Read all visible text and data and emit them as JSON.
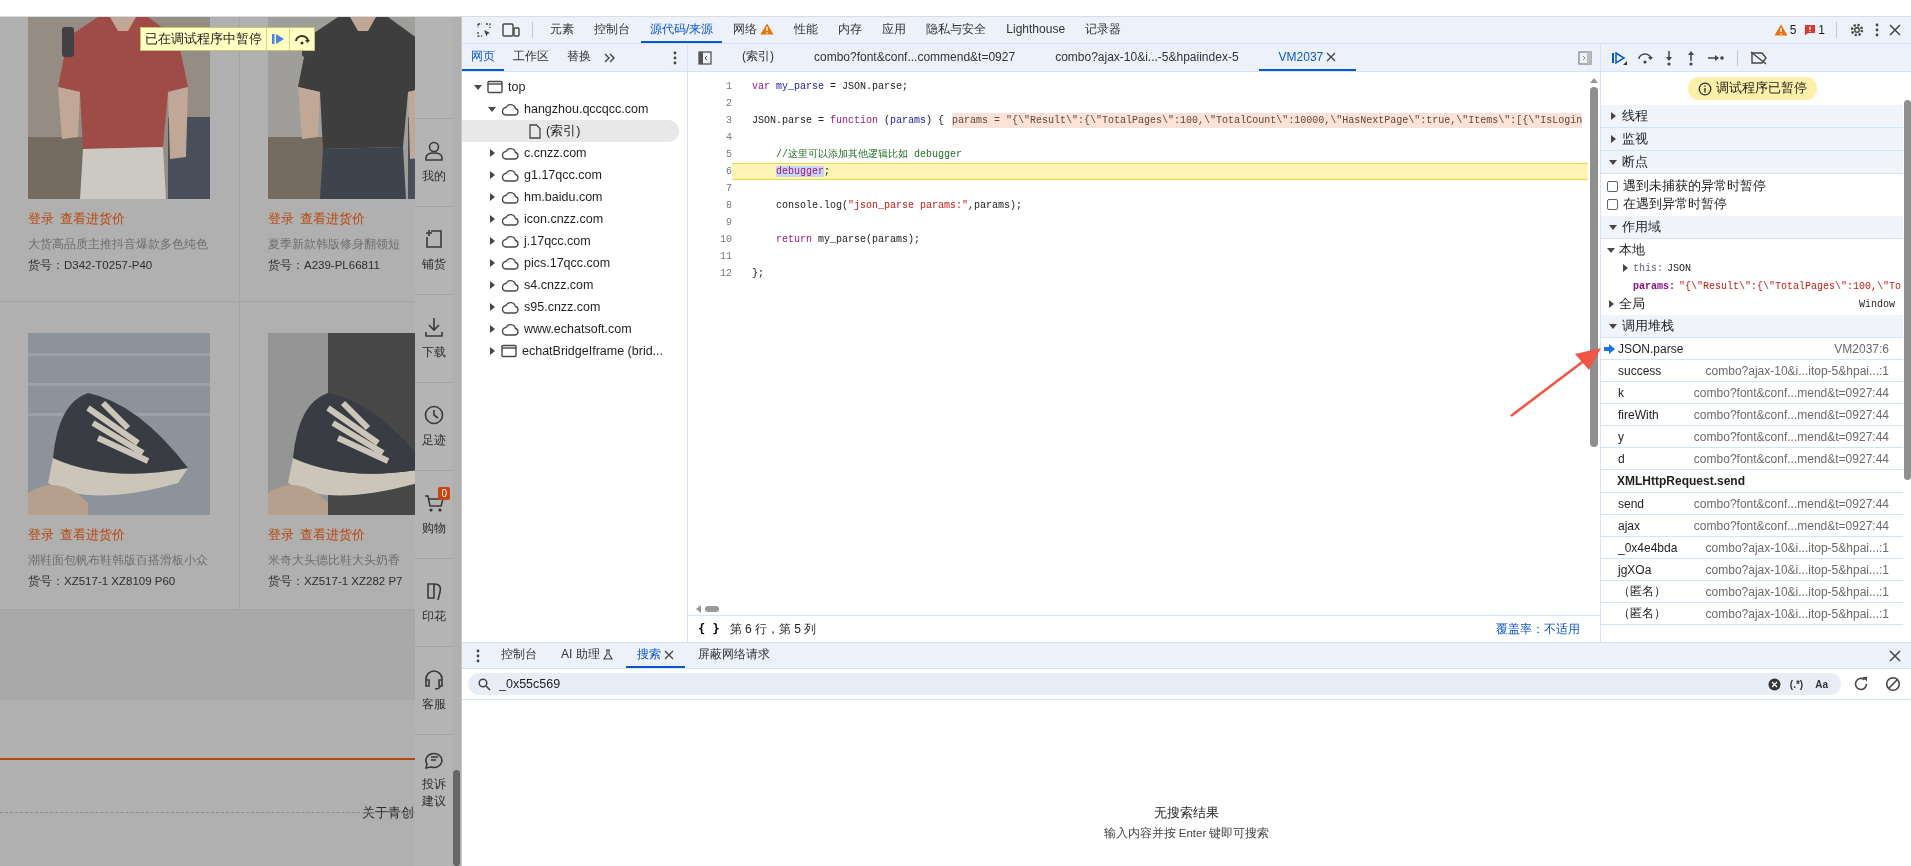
{
  "page": {
    "paused_banner": {
      "text": "已在调试程序中暂停"
    },
    "products": [
      {
        "login": "登录",
        "price_link": "查看进货价",
        "title": "大货高品质主推抖音爆款多色纯色",
        "sku": "货号：D342-T0257-P40"
      },
      {
        "login": "登录",
        "price_link": "查看进货价",
        "title": "夏季新款韩版修身翻领短",
        "sku": "货号：A239-PL66811"
      },
      {
        "login": "登录",
        "price_link": "查看进货价",
        "title": "潮鞋面包帆布鞋韩版百搭滑板小众",
        "sku": "货号：XZ517-1 XZ8109 P60"
      },
      {
        "login": "登录",
        "price_link": "查看进货价",
        "title": "米奇大头德比鞋大头奶香",
        "sku": "货号：XZ517-1 XZ282 P7"
      }
    ],
    "footer_link": "关于青创",
    "sidebar": [
      {
        "kind": "user",
        "label": "我的"
      },
      {
        "kind": "add",
        "label": "铺货"
      },
      {
        "kind": "download",
        "label": "下载"
      },
      {
        "kind": "history",
        "label": "足迹"
      },
      {
        "kind": "cart",
        "label": "购物",
        "badge": "0"
      },
      {
        "kind": "print",
        "label": "印花"
      },
      {
        "kind": "headset",
        "label": "客服"
      },
      {
        "kind": "feedback",
        "label": "投诉建议"
      }
    ]
  },
  "devtools": {
    "main_tabs": [
      {
        "label": "元素",
        "selected": false,
        "warning": false
      },
      {
        "label": "控制台",
        "selected": false,
        "warning": false
      },
      {
        "label": "源代码/来源",
        "selected": true,
        "warning": false
      },
      {
        "label": "网络",
        "selected": false,
        "warning": true
      },
      {
        "label": "性能",
        "selected": false,
        "warning": false
      },
      {
        "label": "内存",
        "selected": false,
        "warning": false
      },
      {
        "label": "应用",
        "selected": false,
        "warning": false
      },
      {
        "label": "隐私与安全",
        "selected": false,
        "warning": false
      },
      {
        "label": "Lighthouse",
        "selected": false,
        "warning": false
      },
      {
        "label": "记录器",
        "selected": false,
        "warning": false
      }
    ],
    "issues": {
      "warnings": "5",
      "errors": "1"
    },
    "navigator_tabs": [
      {
        "label": "网页",
        "selected": true
      },
      {
        "label": "工作区",
        "selected": false
      },
      {
        "label": "替换",
        "selected": false
      }
    ],
    "file_tree": [
      {
        "label": "top",
        "kind": "frame",
        "expanded": true,
        "selected": false,
        "children": [
          {
            "label": "hangzhou.qccqcc.com",
            "kind": "domain",
            "expanded": true,
            "selected": false,
            "children": [
              {
                "label": "(索引)",
                "kind": "file",
                "selected": true
              }
            ]
          },
          {
            "label": "c.cnzz.com",
            "kind": "domain",
            "expanded": false,
            "selected": false
          },
          {
            "label": "g1.17qcc.com",
            "kind": "domain",
            "expanded": false,
            "selected": false
          },
          {
            "label": "hm.baidu.com",
            "kind": "domain",
            "expanded": false,
            "selected": false
          },
          {
            "label": "icon.cnzz.com",
            "kind": "domain",
            "expanded": false,
            "selected": false
          },
          {
            "label": "j.17qcc.com",
            "kind": "domain",
            "expanded": false,
            "selected": false
          },
          {
            "label": "pics.17qcc.com",
            "kind": "domain",
            "expanded": false,
            "selected": false
          },
          {
            "label": "s4.cnzz.com",
            "kind": "domain",
            "expanded": false,
            "selected": false
          },
          {
            "label": "s95.cnzz.com",
            "kind": "domain",
            "expanded": false,
            "selected": false
          },
          {
            "label": "www.echatsoft.com",
            "kind": "domain",
            "expanded": false,
            "selected": false
          },
          {
            "label": "echatBridgeIframe (brid...",
            "kind": "frame",
            "expanded": false,
            "selected": false
          }
        ]
      }
    ],
    "editor_tabs": [
      {
        "label": "(索引)",
        "selected": false
      },
      {
        "label": "combo?font&conf...commend&t=0927",
        "selected": false
      },
      {
        "label": "combo?ajax-10&i...-5&hpaiindex-5",
        "selected": false
      },
      {
        "label": "VM2037",
        "selected": true
      }
    ],
    "lines": [
      {
        "number": "1",
        "paused": false,
        "indented": false,
        "tokens": [
          {
            "kind": "keyword",
            "text": "var "
          },
          {
            "kind": "def",
            "text": "my_parse"
          },
          {
            "kind": "plain",
            "text": " = JSON.parse;"
          }
        ]
      },
      {
        "number": "2",
        "paused": false
      },
      {
        "number": "3",
        "paused": false,
        "indented": false,
        "tokens": [
          {
            "kind": "plain",
            "text": "JSON.parse = "
          },
          {
            "kind": "keyword",
            "text": "function"
          },
          {
            "kind": "plain",
            "text": " ("
          },
          {
            "kind": "def",
            "text": "params"
          },
          {
            "kind": "plain",
            "text": ") {"
          }
        ],
        "inline_value": "params = \"{\\\"Result\\\":{\\\"TotalPages\\\":100,\\\"TotalCount\\\":10000,\\\"HasNextPage\\\":true,\\\"Items\\\":[{\\\"IsLogin"
      },
      {
        "number": "4",
        "paused": false
      },
      {
        "number": "5",
        "paused": false,
        "indented": true,
        "tokens": [
          {
            "kind": "comment",
            "text": "//这里可以添加其他逻辑比如 debugger"
          }
        ]
      },
      {
        "number": "6",
        "paused": true,
        "indented": true,
        "tokens": [
          {
            "kind": "selection",
            "text": "debugger"
          },
          {
            "kind": "plain",
            "text": ";"
          }
        ]
      },
      {
        "number": "7",
        "paused": false
      },
      {
        "number": "8",
        "paused": false,
        "indented": true,
        "tokens": [
          {
            "kind": "plain",
            "text": "console.log("
          },
          {
            "kind": "string",
            "text": "\"json_parse params:\""
          },
          {
            "kind": "plain",
            "text": ",params);"
          }
        ]
      },
      {
        "number": "9",
        "paused": false
      },
      {
        "number": "10",
        "paused": false,
        "indented": true,
        "tokens": [
          {
            "kind": "keyword",
            "text": "return"
          },
          {
            "kind": "plain",
            "text": " my_parse(params);"
          }
        ]
      },
      {
        "number": "11",
        "paused": false
      },
      {
        "number": "12",
        "paused": false,
        "indented": false,
        "tokens": [
          {
            "kind": "plain",
            "text": "};"
          }
        ]
      }
    ],
    "status": {
      "format_button": "{ }",
      "position": "第 6 行，第 5 列",
      "coverage": "覆盖率：不适用"
    },
    "debugger": {
      "paused_notice": "调试程序已暂停",
      "threads": {
        "title": "线程",
        "expanded": false
      },
      "watch": {
        "title": "监视",
        "expanded": false
      },
      "breakpoints": {
        "title": "断点",
        "expanded": true,
        "options": [
          {
            "label": "遇到未捕获的异常时暂停",
            "checked": false
          },
          {
            "label": "在遇到异常时暂停",
            "checked": false
          }
        ]
      },
      "scope": {
        "title": "作用域",
        "expanded": true,
        "local": {
          "label": "本地",
          "expanded": true,
          "entries": [
            {
              "key": "this:",
              "value": "JSON",
              "expandable": true
            },
            {
              "key": "params:",
              "value": "\"{\\\"Result\\\":{\\\"TotalPages\\\":100,\\\"To",
              "expandable": false
            }
          ]
        },
        "global": {
          "label": "全局",
          "expanded": false,
          "value": "Window"
        }
      },
      "call_stack": {
        "title": "调用堆栈",
        "expanded": true,
        "frames": [
          {
            "kind": "frame",
            "name": "JSON.parse",
            "location": "VM2037:6",
            "current": true
          },
          {
            "kind": "frame",
            "name": "success",
            "location": "combo?ajax-10&i...itop-5&hpai...:1",
            "current": false
          },
          {
            "kind": "frame",
            "name": "k",
            "location": "combo?font&conf...mend&t=0927:44",
            "current": false
          },
          {
            "kind": "frame",
            "name": "fireWith",
            "location": "combo?font&conf...mend&t=0927:44",
            "current": false
          },
          {
            "kind": "frame",
            "name": "y",
            "location": "combo?font&conf...mend&t=0927:44",
            "current": false
          },
          {
            "kind": "frame",
            "name": "d",
            "location": "combo?font&conf...mend&t=0927:44",
            "current": false
          },
          {
            "kind": "async",
            "name": "XMLHttpRequest.send"
          },
          {
            "kind": "frame",
            "name": "send",
            "location": "combo?font&conf...mend&t=0927:44",
            "current": false
          },
          {
            "kind": "frame",
            "name": "ajax",
            "location": "combo?font&conf...mend&t=0927:44",
            "current": false
          },
          {
            "kind": "frame",
            "name": "_0x4e4bda",
            "location": "combo?ajax-10&i...itop-5&hpai...:1",
            "current": false
          },
          {
            "kind": "frame",
            "name": "jgXOa",
            "location": "combo?ajax-10&i...itop-5&hpai...:1",
            "current": false
          },
          {
            "kind": "frame",
            "name": "（匿名）",
            "location": "combo?ajax-10&i...itop-5&hpai...:1",
            "current": false
          },
          {
            "kind": "frame",
            "name": "（匿名）",
            "location": "combo?ajax-10&i...itop-5&hpai...:1",
            "current": false
          }
        ]
      }
    },
    "drawer": {
      "tabs": [
        {
          "label": "控制台",
          "selected": false,
          "experimental": false
        },
        {
          "label": "AI 助理",
          "selected": false,
          "experimental": true
        },
        {
          "label": "搜索",
          "selected": true,
          "experimental": false
        },
        {
          "label": "屏蔽网络请求",
          "selected": false,
          "experimental": false
        }
      ],
      "search": {
        "value": "_0x55c569",
        "regex_toggle": "(.*)",
        "case_toggle": "Aa"
      },
      "empty_title": "无搜索结果",
      "empty_hint": "输入内容并按 Enter 键即可搜索"
    }
  }
}
